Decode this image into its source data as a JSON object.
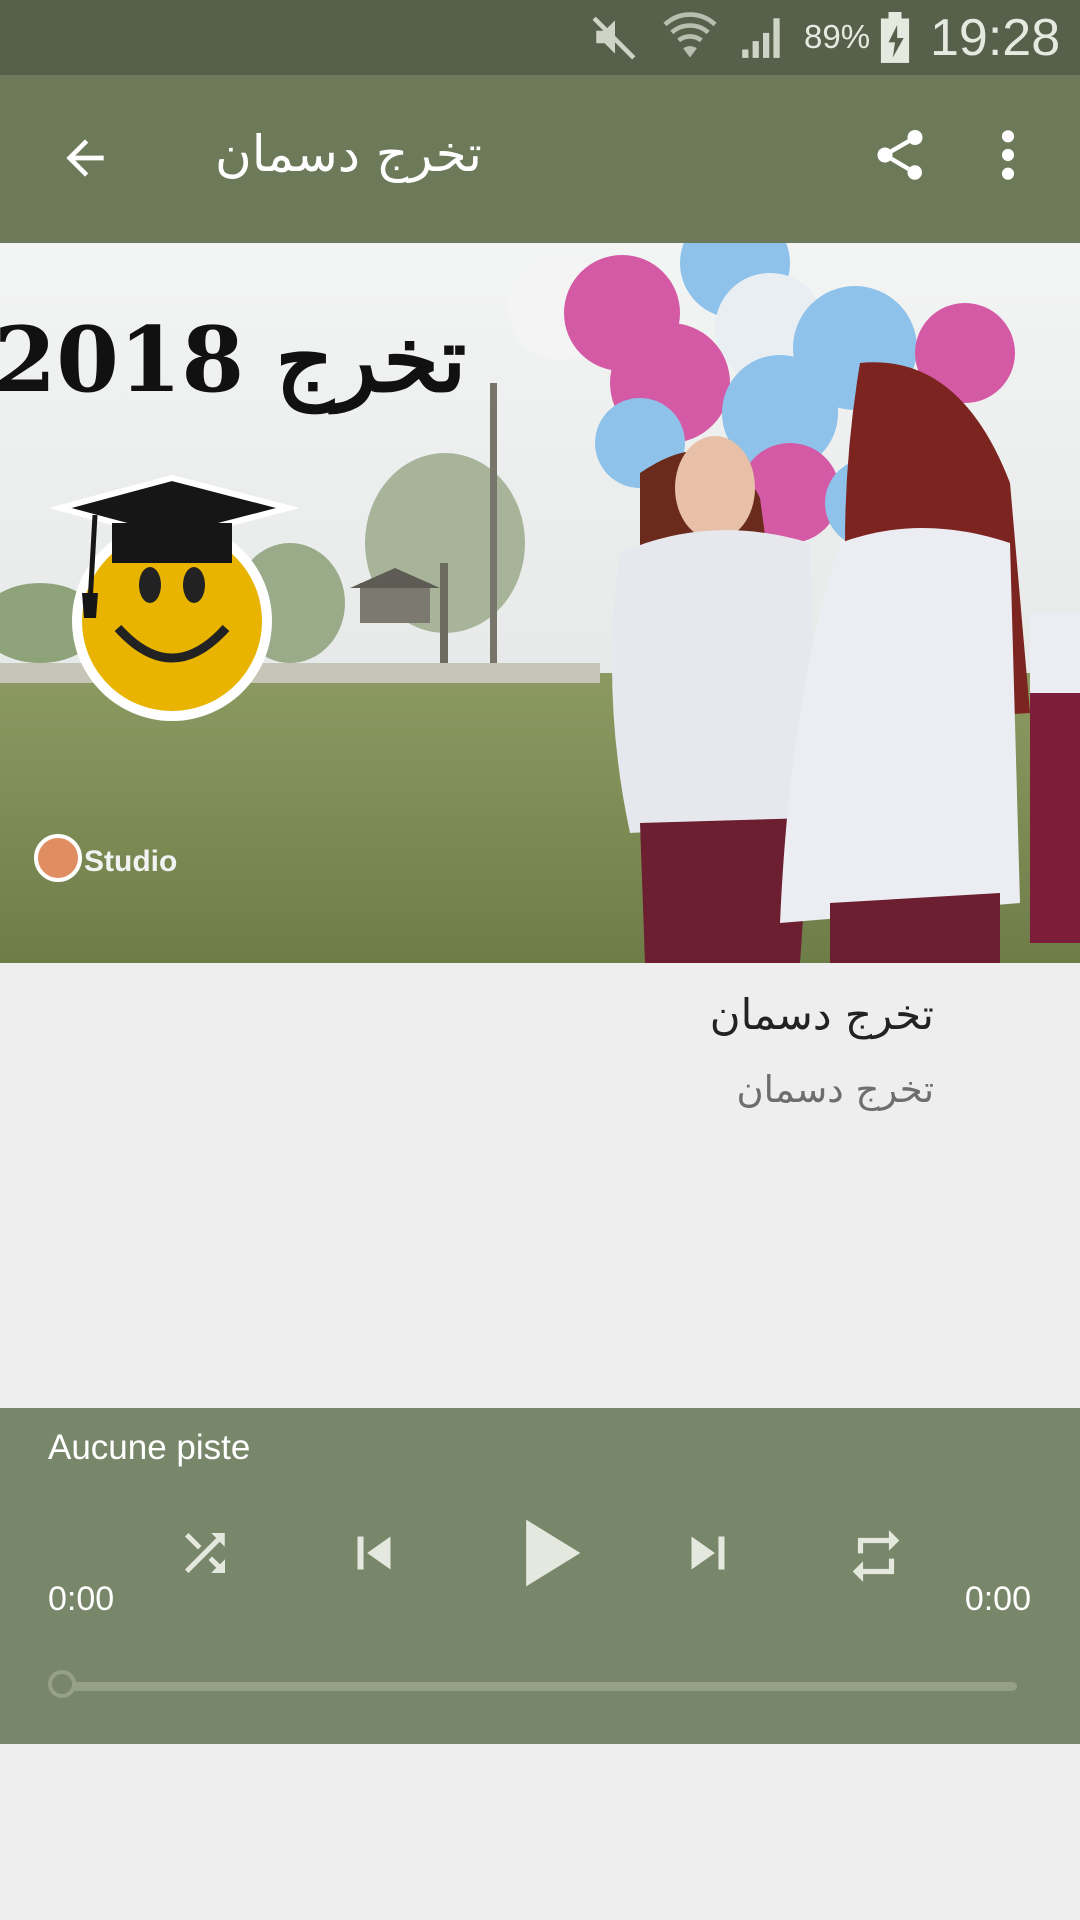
{
  "status_bar": {
    "battery_percent": "89%",
    "time": "19:28",
    "icons": [
      "mute-icon",
      "wifi-icon",
      "signal-icon",
      "battery-charging-icon"
    ]
  },
  "app_bar": {
    "title": "تخرج دسمان",
    "icons": [
      "back-arrow-icon",
      "share-icon",
      "more-vert-icon"
    ]
  },
  "cover": {
    "overlay_text": "تخرج 2018",
    "watermark_text": "Studio"
  },
  "track": {
    "title": "تخرج دسمان",
    "subtitle": "تخرج دسمان"
  },
  "player": {
    "status_text": "Aucune piste",
    "elapsed": "0:00",
    "duration": "0:00",
    "progress": 0,
    "icons": [
      "shuffle-icon",
      "skip-previous-icon",
      "play-icon",
      "skip-next-icon",
      "repeat-icon"
    ]
  },
  "colors": {
    "status_bar": "#56604a",
    "app_bar": "#6d7a5a",
    "player": "#788669",
    "background": "#eeeeee"
  }
}
